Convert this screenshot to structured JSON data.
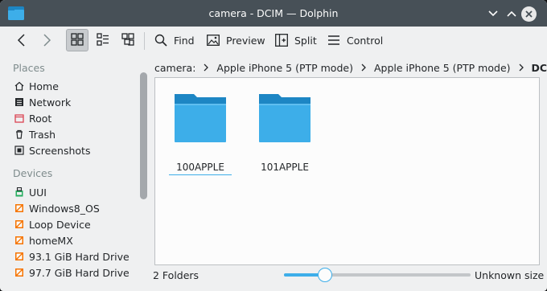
{
  "window": {
    "title": "camera - DCIM — Dolphin"
  },
  "toolbar": {
    "find": "Find",
    "preview": "Preview",
    "split": "Split",
    "control": "Control"
  },
  "places": {
    "title": "Places",
    "items": [
      {
        "label": "Home",
        "icon": "home-icon"
      },
      {
        "label": "Network",
        "icon": "network-icon"
      },
      {
        "label": "Root",
        "icon": "root-folder-icon"
      },
      {
        "label": "Trash",
        "icon": "trash-icon"
      },
      {
        "label": "Screenshots",
        "icon": "screenshots-icon"
      }
    ]
  },
  "devices": {
    "title": "Devices",
    "items": [
      {
        "label": "UUI",
        "icon": "usb-drive-icon"
      },
      {
        "label": "Windows8_OS",
        "icon": "hard-drive-icon"
      },
      {
        "label": "Loop Device",
        "icon": "hard-drive-icon"
      },
      {
        "label": "homeMX",
        "icon": "hard-drive-icon"
      },
      {
        "label": "93.1 GiB Hard Drive",
        "icon": "hard-drive-icon"
      },
      {
        "label": "97.7 GiB Hard Drive",
        "icon": "hard-drive-icon"
      }
    ]
  },
  "breadcrumb": {
    "items": [
      "camera:",
      "Apple iPhone 5 (PTP mode)",
      "Apple iPhone 5 (PTP mode)",
      "DCIM"
    ]
  },
  "files": [
    {
      "name": "100APPLE"
    },
    {
      "name": "101APPLE"
    }
  ],
  "status": {
    "count": "2 Folders",
    "size": "Unknown size",
    "zoom_fraction": 0.22
  },
  "colors": {
    "titlebar": "#475057",
    "accent": "#3daee9",
    "folder_front": "#3daee9",
    "folder_back": "#1d86c4"
  }
}
